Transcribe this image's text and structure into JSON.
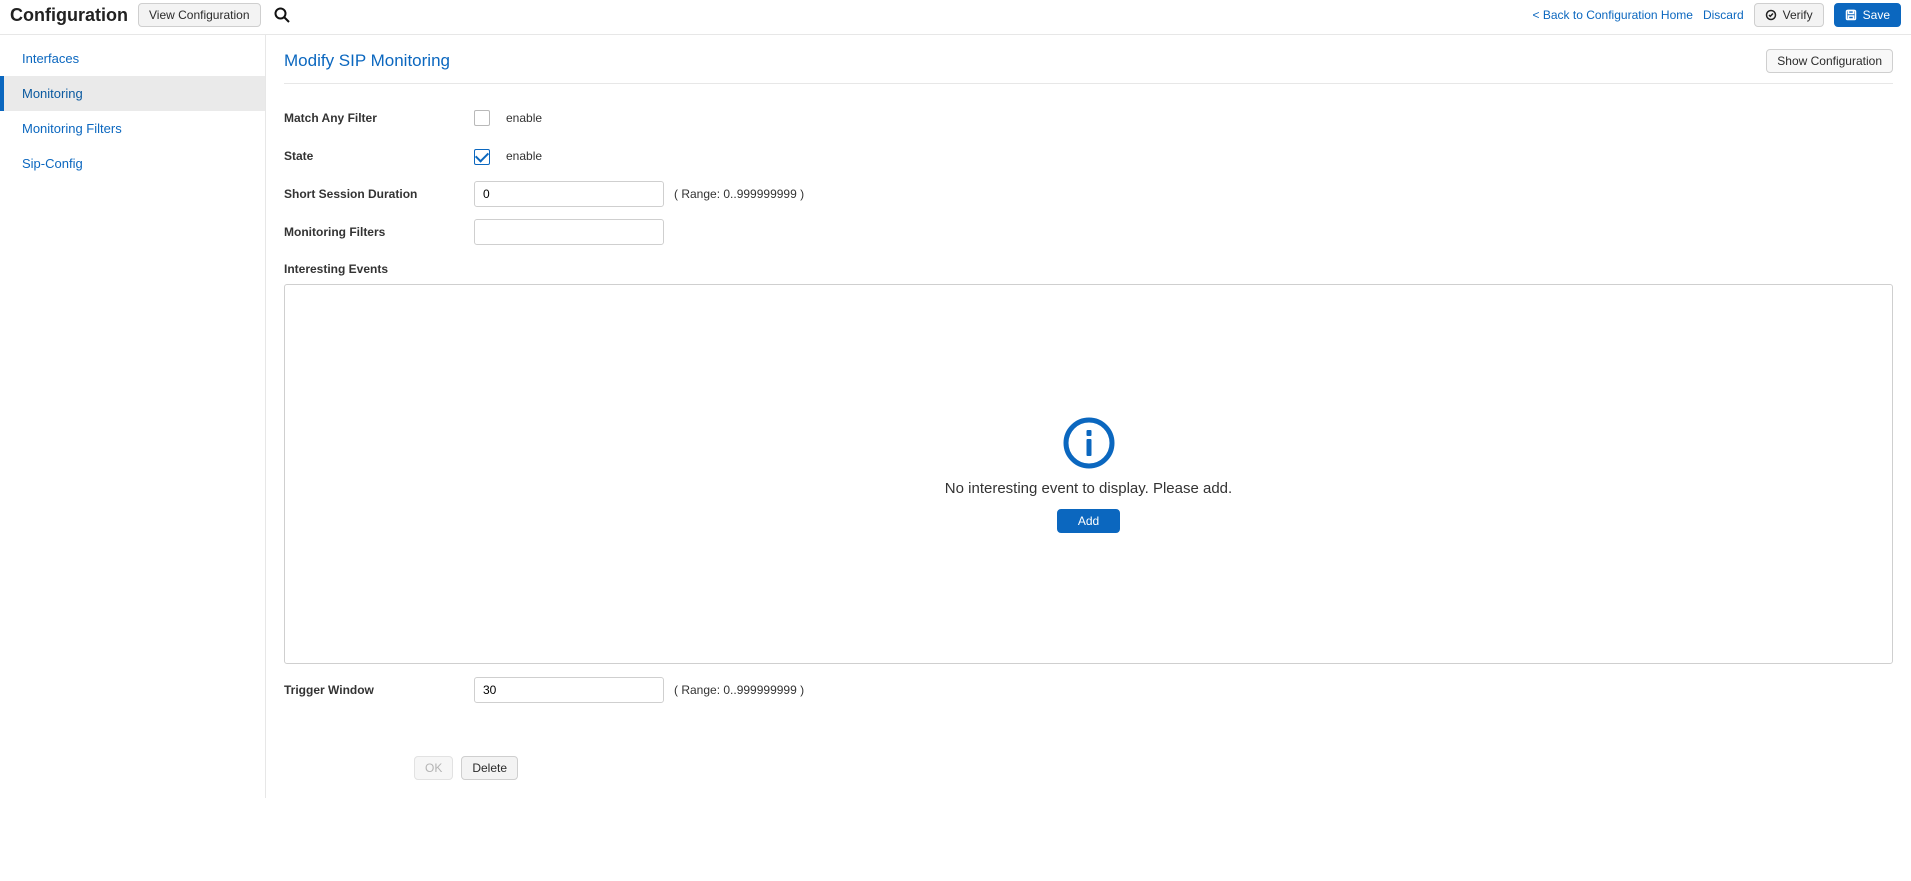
{
  "topbar": {
    "title": "Configuration",
    "view_config_label": "View Configuration",
    "back_link": "< Back to Configuration Home",
    "discard_label": "Discard",
    "verify_label": "Verify",
    "save_label": "Save"
  },
  "sidebar": {
    "items": [
      {
        "label": "Interfaces"
      },
      {
        "label": "Monitoring"
      },
      {
        "label": "Monitoring Filters"
      },
      {
        "label": "Sip-Config"
      }
    ],
    "selected_index": 1
  },
  "main": {
    "title": "Modify SIP Monitoring",
    "show_config_label": "Show Configuration",
    "fields": {
      "match_any_filter": {
        "label": "Match Any Filter",
        "enable_label": "enable",
        "checked": false
      },
      "state": {
        "label": "State",
        "enable_label": "enable",
        "checked": true
      },
      "short_session_duration": {
        "label": "Short Session Duration",
        "value": "0",
        "range_hint": "( Range: 0..999999999 )"
      },
      "monitoring_filters": {
        "label": "Monitoring Filters",
        "value": ""
      },
      "interesting_events": {
        "label": "Interesting Events"
      },
      "trigger_window": {
        "label": "Trigger Window",
        "value": "30",
        "range_hint": "( Range: 0..999999999 )"
      }
    },
    "events_panel": {
      "message": "No interesting event to display. Please add.",
      "add_label": "Add"
    },
    "footer": {
      "ok_label": "OK",
      "delete_label": "Delete"
    }
  }
}
